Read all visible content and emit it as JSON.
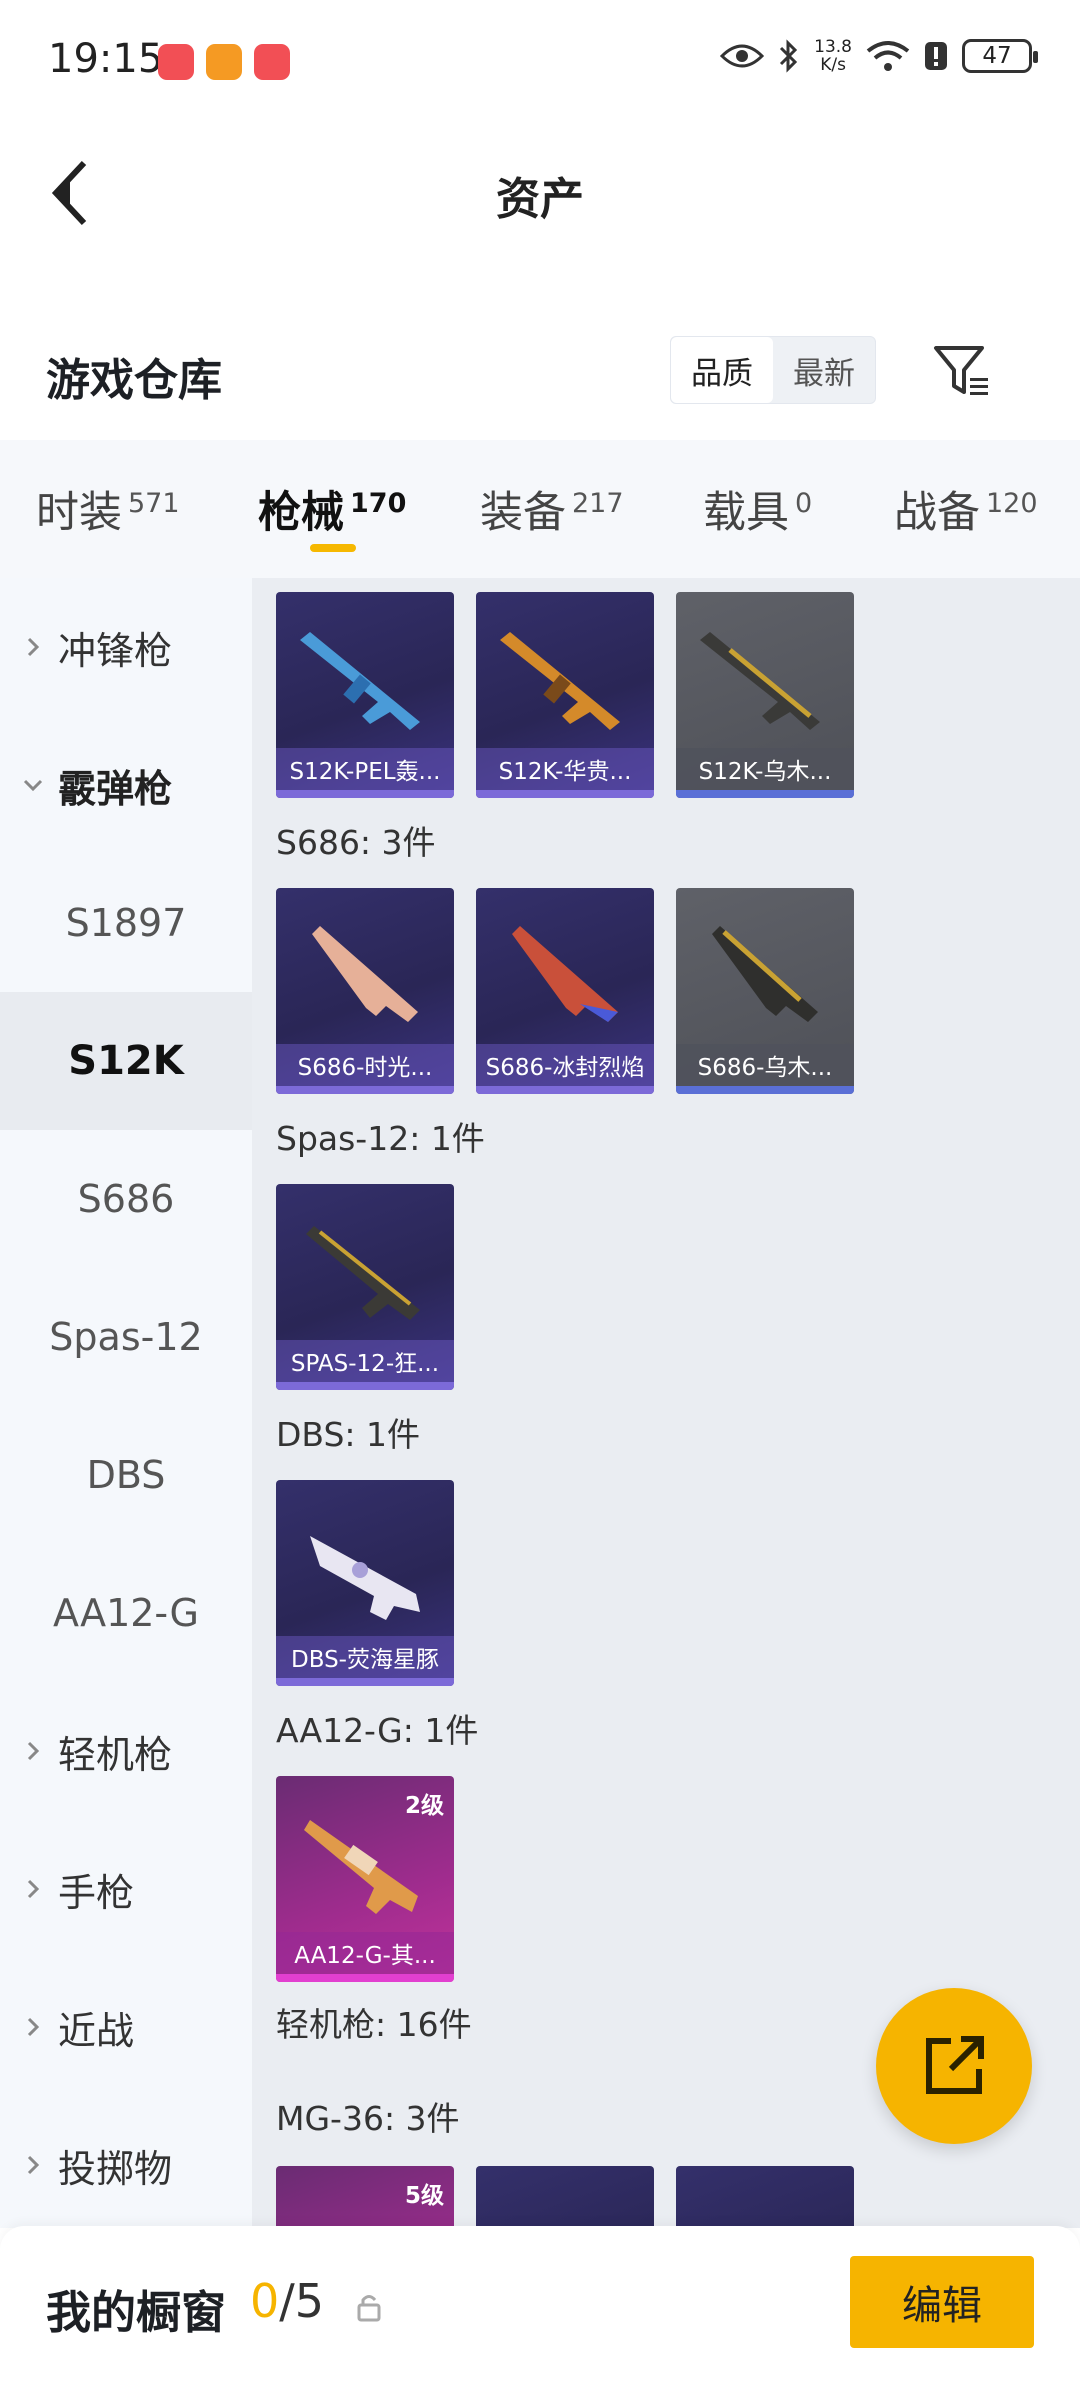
{
  "status_bar": {
    "time": "19:15",
    "net_speed_value": "13.8",
    "net_speed_unit": "K/s",
    "battery": "47",
    "app_icon_colors": [
      "#f24f55",
      "#f59a23",
      "#f24f55"
    ]
  },
  "header": {
    "title": "资产",
    "back_icon": "back-arrow-icon"
  },
  "warehouse": {
    "title": "游戏仓库",
    "sort_options": [
      {
        "label": "品质",
        "active": true
      },
      {
        "label": "最新",
        "active": false
      }
    ],
    "filter_icon": "filter-icon"
  },
  "tabs": [
    {
      "label": "时装",
      "count": "571",
      "active": false
    },
    {
      "label": "枪械",
      "count": "170",
      "active": true
    },
    {
      "label": "装备",
      "count": "217",
      "active": false
    },
    {
      "label": "载具",
      "count": "0",
      "active": false
    },
    {
      "label": "战备",
      "count": "120",
      "active": false
    }
  ],
  "sidebar": [
    {
      "label": "冲锋枪",
      "type": "group",
      "expanded": false
    },
    {
      "label": "霰弹枪",
      "type": "group",
      "expanded": true
    },
    {
      "label": "S1897",
      "type": "sub"
    },
    {
      "label": "S12K",
      "type": "sub",
      "selected": true
    },
    {
      "label": "S686",
      "type": "sub"
    },
    {
      "label": "Spas-12",
      "type": "sub"
    },
    {
      "label": "DBS",
      "type": "sub"
    },
    {
      "label": "AA12-G",
      "type": "sub"
    },
    {
      "label": "轻机枪",
      "type": "group",
      "expanded": false
    },
    {
      "label": "手枪",
      "type": "group",
      "expanded": false
    },
    {
      "label": "近战",
      "type": "group",
      "expanded": false
    },
    {
      "label": "投掷物",
      "type": "group",
      "expanded": false
    }
  ],
  "sections": [
    {
      "label": "",
      "items": [
        {
          "name": "S12K-PEL轰...",
          "rarity": "purple"
        },
        {
          "name": "S12K-华贵...",
          "rarity": "purple"
        },
        {
          "name": "S12K-乌木...",
          "rarity": "grey"
        }
      ]
    },
    {
      "label": "S686: 3件",
      "items": [
        {
          "name": "S686-时光...",
          "rarity": "purple"
        },
        {
          "name": "S686-冰封烈焰",
          "rarity": "purple"
        },
        {
          "name": "S686-乌木...",
          "rarity": "grey"
        }
      ]
    },
    {
      "label": "Spas-12: 1件",
      "items": [
        {
          "name": "SPAS-12-狂...",
          "rarity": "purple"
        }
      ]
    },
    {
      "label": "DBS: 1件",
      "items": [
        {
          "name": "DBS-荧海星豚",
          "rarity": "purple"
        }
      ]
    },
    {
      "label": "AA12-G: 1件",
      "items": [
        {
          "name": "AA12-G-其...",
          "rarity": "pink",
          "level": "2级"
        }
      ]
    },
    {
      "label": "轻机枪: 16件",
      "items": []
    },
    {
      "label": "MG-36: 3件",
      "items": [
        {
          "name": "",
          "rarity": "pink",
          "level": "5级"
        },
        {
          "name": "",
          "rarity": "purple"
        },
        {
          "name": "",
          "rarity": "purple"
        }
      ]
    }
  ],
  "fab_icon": "share-icon",
  "bottom_bar": {
    "title": "我的橱窗",
    "used": "0",
    "total": "/5",
    "lock_icon": "lock-icon",
    "edit_label": "编辑"
  }
}
